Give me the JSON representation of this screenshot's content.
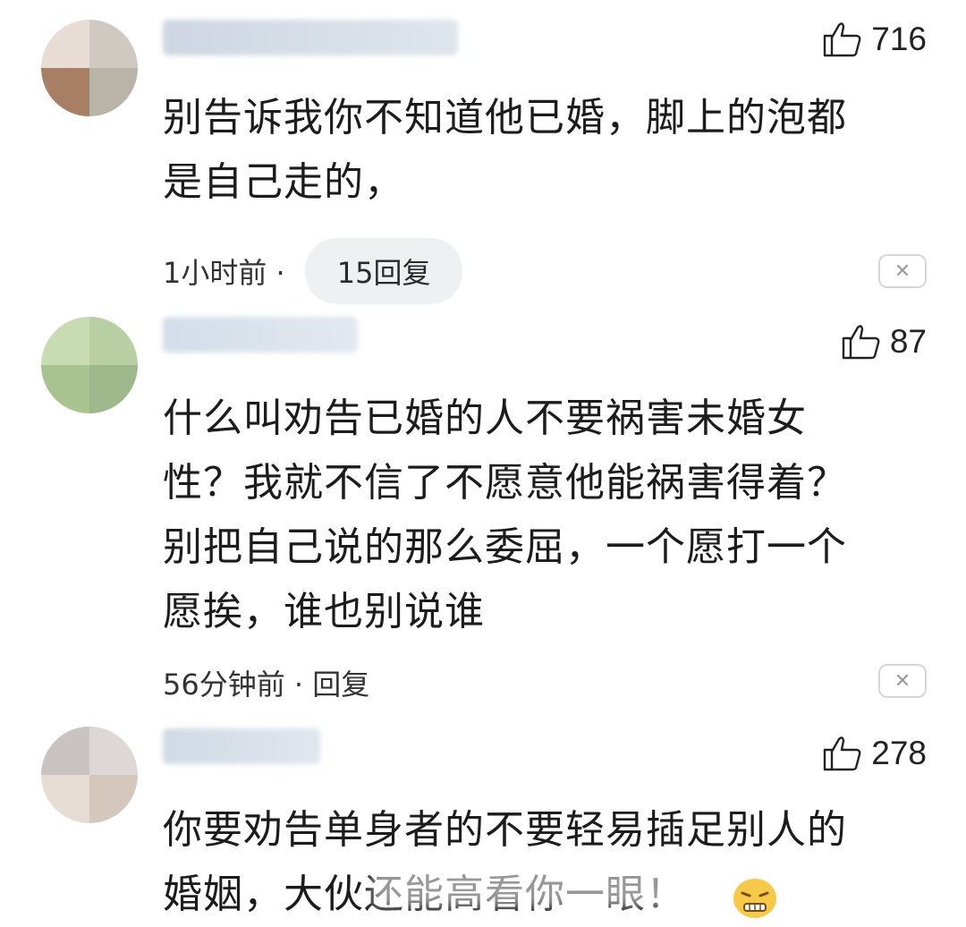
{
  "comments": [
    {
      "likes": "716",
      "text_lines": [
        "别告诉我你不知道他已婚，脚上的泡都",
        "是自己走的，"
      ],
      "time": "1小时前 ·",
      "reply": "15回复",
      "avatar_colors": [
        "#e7ddd5",
        "#cfc9c2",
        "#a77f64",
        "#b9b3a8"
      ],
      "name_colors": [
        "#cdd6e2",
        "#dfe5ec"
      ]
    },
    {
      "likes": "87",
      "text_lines": [
        "什么叫劝告已婚的人不要祸害未婚女",
        "性？我就不信了不愿意他能祸害得着？",
        "别把自己说的那么委屈，一个愿打一个",
        "愿挨，谁也别说谁"
      ],
      "time": "56分钟前 · 回复",
      "avatar_colors": [
        "#c8dcb4",
        "#b7cfa3",
        "#a8c38f",
        "#9fb88b"
      ],
      "name_colors": [
        "#d3dde8",
        "#e2e8ef"
      ]
    },
    {
      "likes": "278",
      "text_lines": [
        "你要劝告单身者的不要轻易插足别人的",
        "婚姻，大伙还能高看你一眼！"
      ],
      "avatar_colors": [
        "#c9c4c1",
        "#ddd8d5",
        "#e6dcd3",
        "#d4c8bc"
      ],
      "name_colors": [
        "#d0dae5",
        "#e0e6ed"
      ]
    }
  ],
  "icons": {
    "like": "thumbs-up-icon",
    "close": "close-icon",
    "emoji": "grimace-emoji-icon"
  },
  "accent": "#eef0f2"
}
